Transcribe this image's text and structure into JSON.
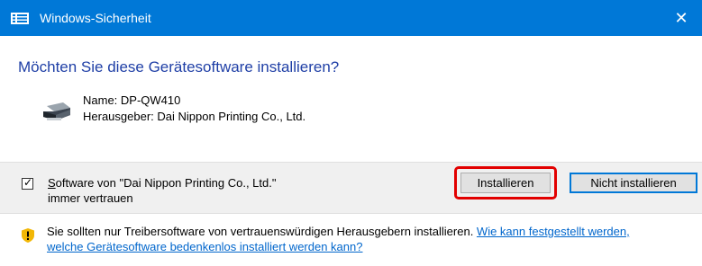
{
  "window": {
    "title": "Windows-Sicherheit",
    "close_glyph": "✕",
    "accent_color": "#0078d7"
  },
  "prompt": {
    "heading": "Möchten Sie diese Gerätesoftware installieren?"
  },
  "device": {
    "icon": "printer-icon",
    "name": "Name: DP-QW410",
    "publisher": "Herausgeber: Dai Nippon Printing Co., Ltd."
  },
  "trust": {
    "checked": true,
    "line1": "Software von \"Dai Nippon Printing Co., Ltd.\"",
    "line2": "immer vertrauen"
  },
  "buttons": {
    "install": "Installieren",
    "dont_install": "Nicht installieren",
    "highlight_color": "#e20000"
  },
  "warning": {
    "icon": "shield-warning-icon",
    "text": "Sie sollten nur Treibersoftware von vertrauenswürdigen Herausgebern installieren. ",
    "link_line1": "Wie kann festgestellt werden,",
    "link_line2": "welche Gerätesoftware bedenkenlos installiert werden kann?"
  }
}
